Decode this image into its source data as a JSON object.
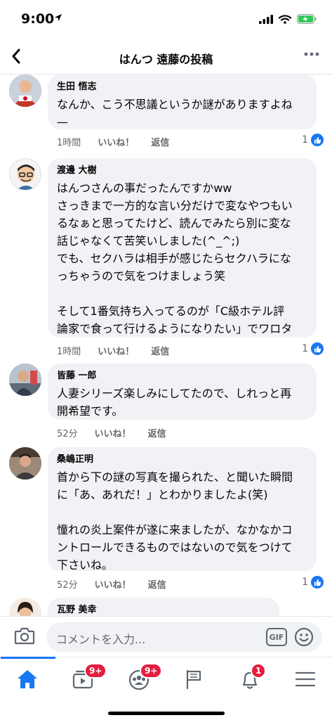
{
  "status_bar": {
    "time": "9:00"
  },
  "header": {
    "title": "はんつ 遠藤の投稿"
  },
  "comments": [
    {
      "name": "生田 悟志",
      "text": "なんか、こう不思議というか謎がありますよね\n—",
      "time": "1時間",
      "like": "いいね！",
      "reply": "返信",
      "likes": "1"
    },
    {
      "name": "渡邊 大樹",
      "text": "はんつさんの事だったんですかww\nさっきまで一方的な言い分だけで変なやつもい\nるなぁと思ってたけど、読んでみたら別に変な\n話じゃなくて苦笑いしました(^_^;)\nでも、セクハラは相手が感じたらセクハラにな\nっちゃうので気をつけましょう笑\n\nそして1番気持ち入ってるのが「C級ホテル評\n論家で食って行けるようになりたい」でワロタ",
      "time": "1時間",
      "like": "いいね！",
      "reply": "返信",
      "likes": "1"
    },
    {
      "name": "皆藤 一郎",
      "text": "人妻シリーズ楽しみにしてたので、しれっと再\n開希望です。",
      "time": "52分",
      "like": "いいね！",
      "reply": "返信",
      "likes": ""
    },
    {
      "name": "桑嶋正明",
      "text": "首から下の謎の写真を撮られた、と聞いた瞬間\nに「あ、あれだ！」とわかりましたよ(笑)\n\n憧れの炎上案件が遂に来ましたが、なかなかコ\nントロールできるものではないので気をつけて\n下さいね。",
      "time": "52分",
      "like": "いいね！",
      "reply": "返信",
      "likes": "1"
    },
    {
      "name": "瓦野 美幸",
      "text": "",
      "time": "",
      "like": "",
      "reply": "",
      "likes": ""
    }
  ],
  "composer": {
    "placeholder": "コメントを入力...",
    "gif_label": "GIF"
  },
  "tabbar": {
    "items": [
      {
        "icon": "home-icon",
        "badge": ""
      },
      {
        "icon": "watch-icon",
        "badge": "9+"
      },
      {
        "icon": "groups-icon",
        "badge": "9+"
      },
      {
        "icon": "pages-flag-icon",
        "badge": ""
      },
      {
        "icon": "notifications-bell-icon",
        "badge": "1"
      },
      {
        "icon": "menu-icon",
        "badge": ""
      }
    ]
  },
  "colors": {
    "accent": "#1877f2",
    "badge": "#e41e3f",
    "bubble": "#f0f2f5",
    "battery": "#34c759"
  }
}
